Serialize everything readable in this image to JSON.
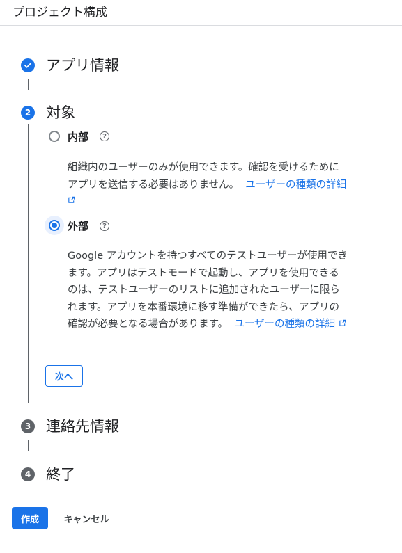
{
  "header": {
    "title": "プロジェクト構成"
  },
  "steps": [
    {
      "number": "1",
      "title": "アプリ情報",
      "status": "done"
    },
    {
      "number": "2",
      "title": "対象",
      "status": "active"
    },
    {
      "number": "3",
      "title": "連絡先情報",
      "status": "pending"
    },
    {
      "number": "4",
      "title": "終了",
      "status": "pending"
    }
  ],
  "audience": {
    "internal": {
      "label": "内部",
      "help": "?",
      "desc_line1": "組織内のユーザーのみが使用できます。確認を受けるために",
      "desc_line2": "アプリを送信する必要はありません。",
      "link": "ユーザーの種類の詳細",
      "selected": false
    },
    "external": {
      "label": "外部",
      "help": "?",
      "desc_line1": "Google アカウントを持つすべてのテストユーザーが使用でき",
      "desc_line2": "ます。アプリはテストモードで起動し、アプリを使用できる",
      "desc_line3": "のは、テストユーザーのリストに追加されたユーザーに限ら",
      "desc_line4": "れます。アプリを本番環境に移す準備ができたら、アプリの",
      "desc_line5": "確認が必要となる場合があります。",
      "link": "ユーザーの種類の詳細",
      "selected": true
    },
    "next_button": "次へ"
  },
  "footer": {
    "create_button": "作成",
    "cancel_button": "キャンセル"
  },
  "icons": {
    "check": "check-icon",
    "external_link": "external-link-icon",
    "help": "help-icon"
  },
  "colors": {
    "accent": "#1a73e8",
    "pending": "#5f6368"
  }
}
